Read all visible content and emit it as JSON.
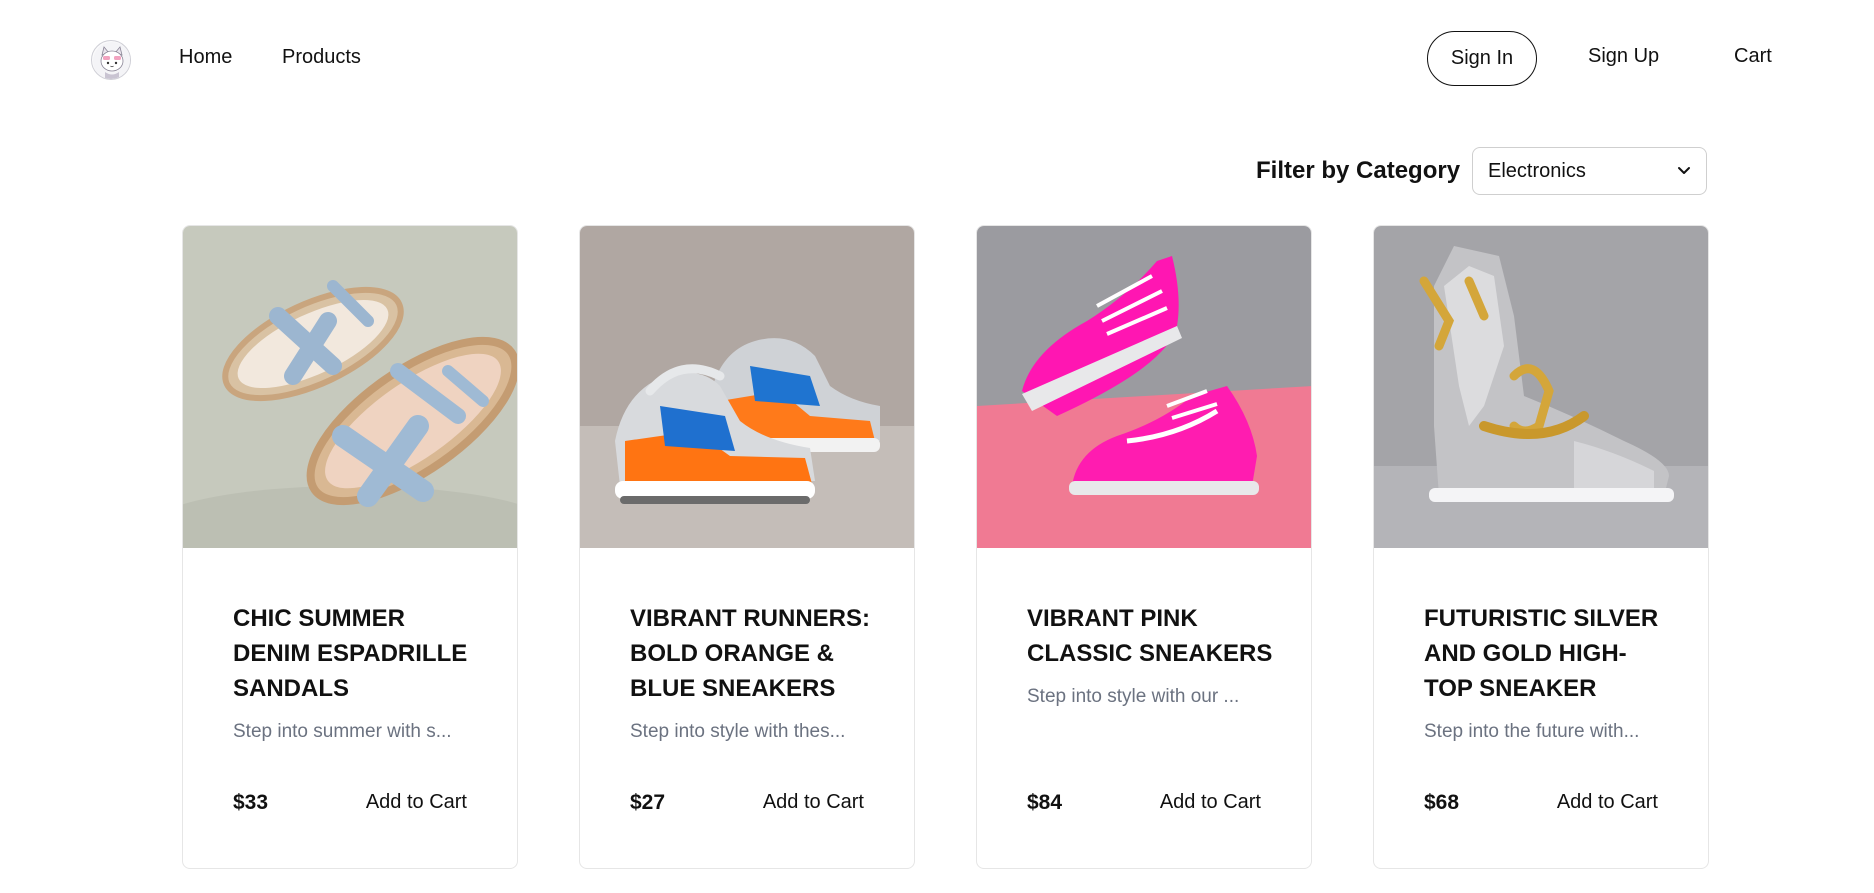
{
  "nav": {
    "logo_icon": "cat-avatar-icon",
    "home": "Home",
    "products": "Products",
    "sign_in": "Sign In",
    "sign_up": "Sign Up",
    "cart": "Cart"
  },
  "filter": {
    "label": "Filter by Category",
    "selected": "Electronics"
  },
  "products": [
    {
      "title": "CHIC SUMMER DENIM ESPADRILLE SANDALS",
      "description": "Step into summer with s...",
      "price": "$33",
      "add_label": "Add to Cart",
      "image_icon": "denim-sandals-image"
    },
    {
      "title": "VIBRANT RUNNERS: BOLD ORANGE & BLUE SNEAKERS",
      "description": "Step into style with thes...",
      "price": "$27",
      "add_label": "Add to Cart",
      "image_icon": "orange-blue-sneakers-image"
    },
    {
      "title": "VIBRANT PINK CLASSIC SNEAKERS",
      "description": "Step into style with our ...",
      "price": "$84",
      "add_label": "Add to Cart",
      "image_icon": "pink-sneakers-image"
    },
    {
      "title": "FUTURISTIC SILVER AND GOLD HIGH-TOP SNEAKER",
      "description": "Step into the future with...",
      "price": "$68",
      "add_label": "Add to Cart",
      "image_icon": "silver-gold-hightop-image"
    }
  ]
}
